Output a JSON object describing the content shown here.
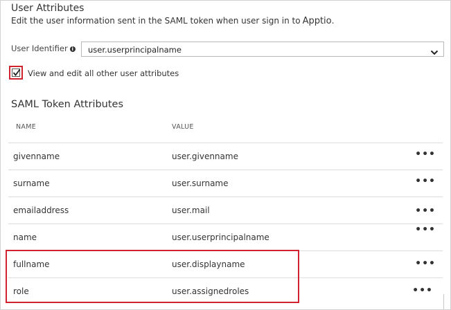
{
  "header": {
    "title": "User Attributes",
    "subtitle": "Edit the user information sent in the SAML token when user sign in to",
    "app_name": "Apptio",
    "subtitle_end": "."
  },
  "user_identifier": {
    "label": "User Identifier",
    "value": "user.userprincipalname"
  },
  "checkbox": {
    "label": "View and edit all other user attributes",
    "checked": true
  },
  "saml": {
    "title": "SAML Token Attributes",
    "columns": [
      "NAME",
      "VALUE"
    ],
    "rows": [
      {
        "name": "givenname",
        "value": "user.givenname",
        "more": "•••"
      },
      {
        "name": "surname",
        "value": "user.surname",
        "more": "•••"
      },
      {
        "name": "emailaddress",
        "value": "user.mail",
        "more": "•••"
      },
      {
        "name": "name",
        "value": "user.userprincipalname",
        "more": "•••"
      },
      {
        "name": "fullname",
        "value": "user.displayname",
        "more": "•••"
      },
      {
        "name": "role",
        "value": "user.assignedroles",
        "more": "•••"
      }
    ]
  },
  "colors": {
    "highlight": "#d0232f",
    "border": "#dcdcdc"
  }
}
